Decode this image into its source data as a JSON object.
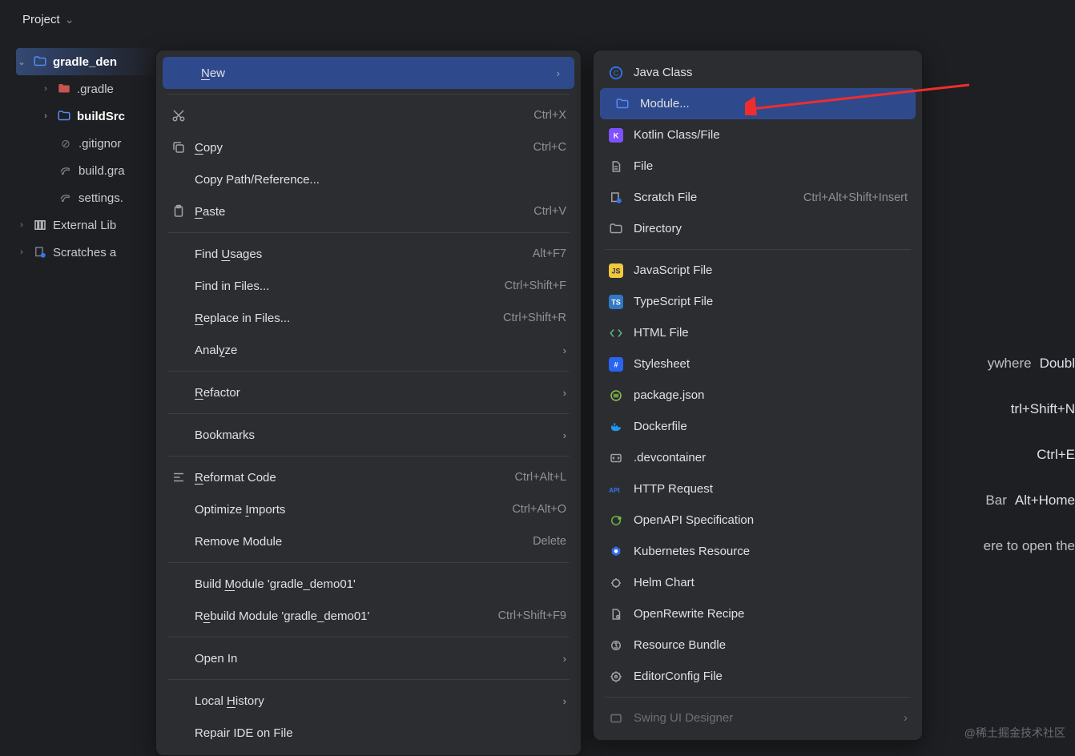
{
  "header": {
    "project_label": "Project"
  },
  "tree": {
    "root": "gradle_den",
    "items": [
      ".gradle",
      "buildSrc",
      ".gitignor",
      "build.gra",
      "settings.",
      "External Lib",
      "Scratches a"
    ]
  },
  "context_menu": [
    {
      "icon": "",
      "label": "New",
      "ul": "N",
      "rest": "ew",
      "shortcut": "",
      "arrow": true,
      "highlight": true
    },
    {
      "sep": true
    },
    {
      "icon": "cut",
      "label": "Cut",
      "ul": "",
      "rest": "",
      "fulllabel": true,
      "underline_idx": 2,
      "shortcut": "Ctrl+X"
    },
    {
      "icon": "copy",
      "label": "Copy",
      "underline_idx": 0,
      "shortcut": "Ctrl+C"
    },
    {
      "icon": "",
      "label": "Copy Path/Reference...",
      "shortcut": ""
    },
    {
      "icon": "paste",
      "label": "Paste",
      "underline_idx": 0,
      "shortcut": "Ctrl+V"
    },
    {
      "sep": true
    },
    {
      "icon": "",
      "label": "Find Usages",
      "underline_idx": 5,
      "shortcut": "Alt+F7"
    },
    {
      "icon": "",
      "label": "Find in Files...",
      "shortcut": "Ctrl+Shift+F"
    },
    {
      "icon": "",
      "label": "Replace in Files...",
      "underline_idx": 0,
      "shortcut": "Ctrl+Shift+R"
    },
    {
      "icon": "",
      "label": "Analyze",
      "underline_idx": 4,
      "shortcut": "",
      "arrow": true
    },
    {
      "sep": true
    },
    {
      "icon": "",
      "label": "Refactor",
      "underline_idx": 0,
      "shortcut": "",
      "arrow": true
    },
    {
      "sep": true
    },
    {
      "icon": "",
      "label": "Bookmarks",
      "shortcut": "",
      "arrow": true
    },
    {
      "sep": true
    },
    {
      "icon": "reformat",
      "label": "Reformat Code",
      "underline_idx": 0,
      "shortcut": "Ctrl+Alt+L"
    },
    {
      "icon": "",
      "label": "Optimize Imports",
      "underline_idx": 9,
      "shortcut": "Ctrl+Alt+O"
    },
    {
      "icon": "",
      "label": "Remove Module",
      "shortcut": "Delete"
    },
    {
      "sep": true
    },
    {
      "icon": "",
      "label": "Build Module 'gradle_demo01'",
      "underline_idx": 6,
      "shortcut": ""
    },
    {
      "icon": "",
      "label": "Rebuild Module 'gradle_demo01'",
      "underline_idx": 1,
      "shortcut": "Ctrl+Shift+F9"
    },
    {
      "sep": true
    },
    {
      "icon": "",
      "label": "Open In",
      "shortcut": "",
      "arrow": true
    },
    {
      "sep": true
    },
    {
      "icon": "",
      "label": "Local History",
      "underline_idx": 6,
      "shortcut": "",
      "arrow": true
    },
    {
      "icon": "",
      "label": "Repair IDE on File",
      "shortcut": ""
    }
  ],
  "submenu": [
    {
      "icon": "c-blue",
      "label": "Java Class"
    },
    {
      "icon": "folder-blue",
      "label": "Module...",
      "highlight": true
    },
    {
      "icon": "k-purple",
      "label": "Kotlin Class/File"
    },
    {
      "icon": "file-lines",
      "label": "File"
    },
    {
      "icon": "scratch",
      "label": "Scratch File",
      "shortcut": "Ctrl+Alt+Shift+Insert"
    },
    {
      "icon": "folder",
      "label": "Directory"
    },
    {
      "sep": true
    },
    {
      "icon": "js",
      "label": "JavaScript File"
    },
    {
      "icon": "ts",
      "label": "TypeScript File"
    },
    {
      "icon": "html",
      "label": "HTML File"
    },
    {
      "icon": "css",
      "label": "Stylesheet"
    },
    {
      "icon": "pkg",
      "label": "package.json"
    },
    {
      "icon": "docker",
      "label": "Dockerfile"
    },
    {
      "icon": "devcont",
      "label": ".devcontainer"
    },
    {
      "icon": "api",
      "label": "HTTP Request"
    },
    {
      "icon": "openapi",
      "label": "OpenAPI Specification"
    },
    {
      "icon": "k8s",
      "label": "Kubernetes Resource"
    },
    {
      "icon": "helm",
      "label": "Helm Chart"
    },
    {
      "icon": "openrewrite",
      "label": "OpenRewrite Recipe"
    },
    {
      "icon": "res",
      "label": "Resource Bundle"
    },
    {
      "icon": "editorconfig",
      "label": "EditorConfig File"
    },
    {
      "sep": true
    },
    {
      "icon": "swing",
      "label": "Swing UI Designer",
      "dim": true,
      "arrow": true
    }
  ],
  "hints": [
    {
      "txt": "ywhere",
      "key": "Doubl"
    },
    {
      "txt": "",
      "key": "trl+Shift+N"
    },
    {
      "txt": "",
      "key": "Ctrl+E"
    },
    {
      "txt": "Bar",
      "key": "Alt+Home"
    },
    {
      "txt": "ere to open the",
      "key": ""
    }
  ],
  "watermark": "@稀土掘金技术社区"
}
